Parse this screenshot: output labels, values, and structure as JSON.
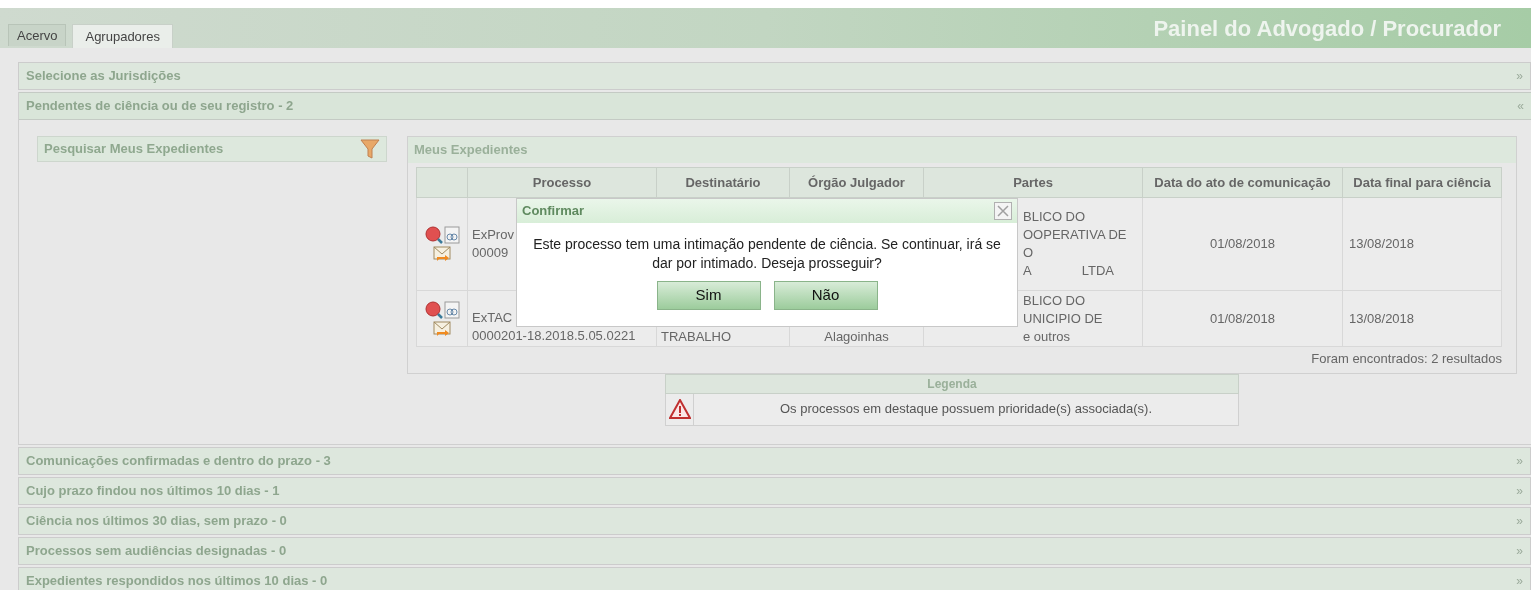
{
  "tabs": [
    {
      "label": "Acervo",
      "selected": false
    },
    {
      "label": "Agrupadores",
      "selected": true
    }
  ],
  "title": "Painel do Advogado / Procurador",
  "sections": [
    {
      "title": "Selecione as Jurisdições",
      "toggle": "»",
      "expanded": false
    },
    {
      "title": "Pendentes de ciência ou de seu registro - 2",
      "toggle": "«",
      "expanded": true,
      "content": {
        "search_panel": {
          "title": "Pesquisar Meus Expedientes"
        },
        "results_panel": {
          "title": "Meus Expedientes",
          "columns": [
            "Processo",
            "Destinatário",
            "Órgão Julgador",
            "Partes",
            "Data do ato de comunicação",
            "Data final para ciência"
          ],
          "rows": [
            {
              "processo": [
                "ExProv",
                "00009"
              ],
              "destinatario": [],
              "orgao": [],
              "partes": [
                [
                  "BLICO DO"
                ],
                [
                  "OOPERATIVA DE"
                ],
                [
                  "O"
                ],
                [
                  "A",
                  "LTDA"
                ]
              ],
              "data_ato": "01/08/2018",
              "data_final": "13/08/2018"
            },
            {
              "processo": [
                "ExTAC",
                "0000201-18.2018.5.05.0221"
              ],
              "destinatario": [
                "TRABALHO"
              ],
              "orgao": [
                "Alagoinhas"
              ],
              "partes": [
                [
                  "BLICO DO"
                ],
                [
                  "UNICIPIO DE"
                ],
                [
                  "e outros"
                ]
              ],
              "data_ato": "01/08/2018",
              "data_final": "13/08/2018"
            }
          ],
          "footer": "Foram encontrados: 2 resultados"
        },
        "legend": {
          "title": "Legenda",
          "text": "Os processos em destaque possuem prioridade(s) associada(s)."
        }
      }
    },
    {
      "title": "Comunicações confirmadas e dentro do prazo - 3",
      "toggle": "»",
      "expanded": false
    },
    {
      "title": "Cujo prazo findou nos últimos 10 dias - 1",
      "toggle": "»",
      "expanded": false
    },
    {
      "title": "Ciência nos últimos 30 dias, sem prazo - 0",
      "toggle": "»",
      "expanded": false
    },
    {
      "title": "Processos sem audiências designadas - 0",
      "toggle": "»",
      "expanded": false
    },
    {
      "title": "Expedientes respondidos nos últimos 10 dias - 0",
      "toggle": "»",
      "expanded": false
    }
  ],
  "dialog": {
    "title": "Confirmar",
    "message": "Este processo tem uma intimação pendente de ciência. Se continuar, irá se dar por intimado. Deseja prosseguir?",
    "buttons": [
      "Sim",
      "Não"
    ]
  }
}
